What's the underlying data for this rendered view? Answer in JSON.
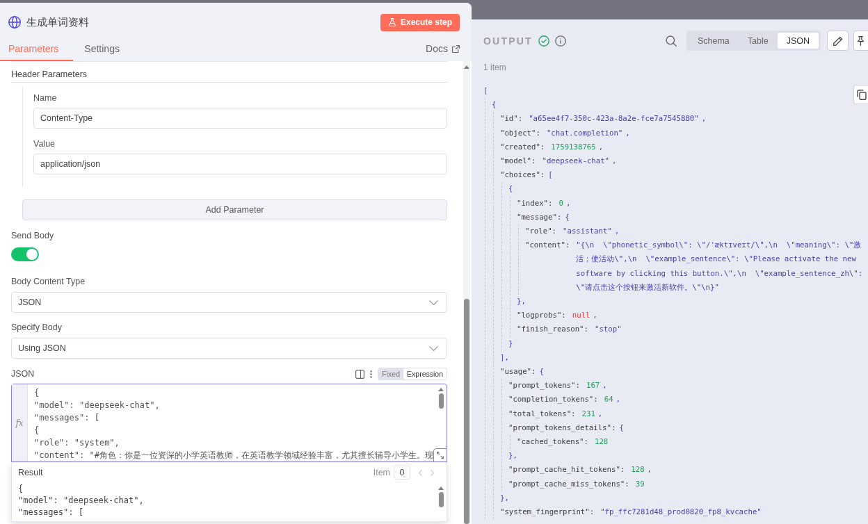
{
  "panel": {
    "title": "生成单词资料",
    "execute_button": "Execute step",
    "tabs": [
      {
        "label": "Parameters",
        "selected": true
      },
      {
        "label": "Settings",
        "selected": false
      }
    ],
    "docs_link": "Docs"
  },
  "header_parameters": {
    "title": "Header Parameters",
    "fields": [
      {
        "label": "Name",
        "value": "Content-Type"
      },
      {
        "label": "Value",
        "value": "application/json"
      }
    ],
    "add_button": "Add Parameter"
  },
  "send_body": {
    "label": "Send Body",
    "on": true
  },
  "selects": [
    {
      "label": "Body Content Type",
      "value": "JSON"
    },
    {
      "label": "Specify Body",
      "value": "Using JSON"
    }
  ],
  "json_field": {
    "label": "JSON",
    "modes": [
      {
        "label": "Fixed",
        "selected": false
      },
      {
        "label": "Expression",
        "selected": true
      }
    ],
    "gutter": "fx",
    "code_lines": [
      "{",
      "\"model\": \"deepseek-chat\",",
      "\"messages\": [",
      "{",
      "\"role\": \"system\",",
      "\"content\": \"#角色：你是一位资深的小学英语教师，在英语教学领域经验丰富，尤其擅长辅导小学生。现"
    ]
  },
  "result": {
    "title": "Result",
    "item_label": "Item",
    "item_value": "0",
    "prev_disabled": true,
    "next_disabled": true,
    "code_lines": [
      "{",
      "\"model\": \"deepseek-chat\",",
      "\"messages\": ["
    ]
  },
  "output": {
    "title": "OUTPUT",
    "views": [
      {
        "label": "Schema",
        "selected": false
      },
      {
        "label": "Table",
        "selected": false
      },
      {
        "label": "JSON",
        "selected": true
      }
    ],
    "count": "1 item",
    "tree": [
      {
        "kind": "container",
        "open": "[",
        "children": [
          {
            "kind": "container",
            "open": "{",
            "children": [
              {
                "kind": "string",
                "key": "\"id\":",
                "value": "\"a65ee4f7-350c-423a-8a2e-fce7a7545880\"",
                "comma": ","
              },
              {
                "kind": "string",
                "key": "\"object\":",
                "value": "\"chat.completion\"",
                "comma": ","
              },
              {
                "kind": "number",
                "key": "\"created\":",
                "value": "1759138765",
                "comma": ","
              },
              {
                "kind": "string",
                "key": "\"model\":",
                "value": "\"deepseek-chat\"",
                "comma": ","
              },
              {
                "kind": "container",
                "key": "\"choices\":",
                "open": "[",
                "close": "],",
                "children": [
                  {
                    "kind": "container",
                    "open": "{",
                    "close": "}",
                    "children": [
                      {
                        "kind": "number",
                        "key": "\"index\":",
                        "value": "0",
                        "comma": ","
                      },
                      {
                        "kind": "container",
                        "key": "\"message\":",
                        "open": "{",
                        "close": "},",
                        "children": [
                          {
                            "kind": "string",
                            "key": "\"role\":",
                            "value": "\"assistant\"",
                            "comma": ","
                          },
                          {
                            "kind": "string",
                            "key": "\"content\":",
                            "value": "\"{\\n  \\\"phonetic_symbol\\\": \\\"/ˈæktɪveɪt/\\\",\\n  \\\"meaning\\\": \\\"激活；使活动\\\",\\n  \\\"example_sentence\\\": \\\"Please activate the new software by clicking this button.\\\",\\n  \\\"example_sentence_zh\\\": \\\"请点击这个按钮来激活新软件。\\\"\\n}\""
                          }
                        ]
                      },
                      {
                        "kind": "null",
                        "key": "\"logprobs\":",
                        "value": "null",
                        "comma": ","
                      },
                      {
                        "kind": "string",
                        "key": "\"finish_reason\":",
                        "value": "\"stop\""
                      }
                    ]
                  }
                ]
              },
              {
                "kind": "container",
                "key": "\"usage\":",
                "open": "{",
                "close": "},",
                "children": [
                  {
                    "kind": "number",
                    "key": "\"prompt_tokens\":",
                    "value": "167",
                    "comma": ","
                  },
                  {
                    "kind": "number",
                    "key": "\"completion_tokens\":",
                    "value": "64",
                    "comma": ","
                  },
                  {
                    "kind": "number",
                    "key": "\"total_tokens\":",
                    "value": "231",
                    "comma": ","
                  },
                  {
                    "kind": "container",
                    "key": "\"prompt_tokens_details\":",
                    "open": "{",
                    "close": "},",
                    "children": [
                      {
                        "kind": "number",
                        "key": "\"cached_tokens\":",
                        "value": "128"
                      }
                    ]
                  },
                  {
                    "kind": "number",
                    "key": "\"prompt_cache_hit_tokens\":",
                    "value": "128",
                    "comma": ","
                  },
                  {
                    "kind": "number",
                    "key": "\"prompt_cache_miss_tokens\":",
                    "value": "39"
                  }
                ]
              },
              {
                "kind": "string",
                "key": "\"system_fingerprint\":",
                "value": "\"fp_ffc7281d48_prod0820_fp8_kvcache\""
              }
            ]
          }
        ]
      }
    ]
  }
}
